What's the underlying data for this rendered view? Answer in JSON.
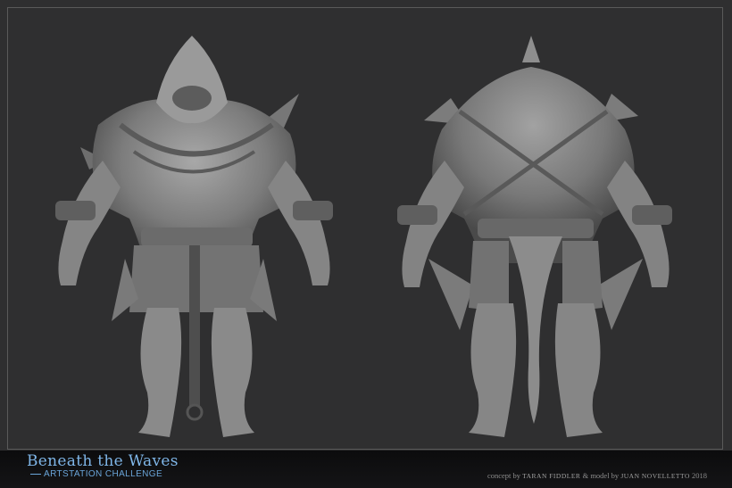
{
  "footer": {
    "title": "Beneath the Waves",
    "subtitle": "ARTSTATION CHALLENGE",
    "credits": {
      "concept_label": "concept by",
      "concept_name": "TARAN FIDDLER",
      "separator": "&",
      "model_label": "model by",
      "model_name": "JUAN NOVELLETTO",
      "year": "2018"
    }
  },
  "colors": {
    "background": "#2f2f30",
    "sculpt": "#8a8a8a",
    "title_blue": "#7fb6e8"
  },
  "views": [
    "front-view",
    "back-view"
  ]
}
